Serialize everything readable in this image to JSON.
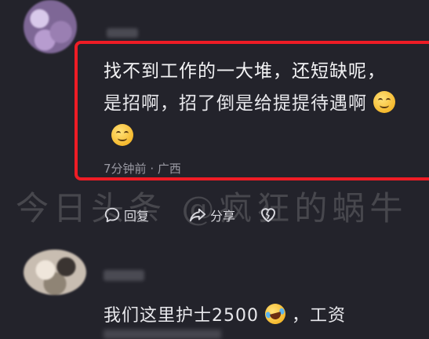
{
  "comment1": {
    "line1": "找不到工作的一大堆，还短缺呢，",
    "line2": "是招啊，招了倒是给提提待遇啊",
    "time": "7分钟前",
    "region": "广西",
    "separator": "·"
  },
  "actions": {
    "reply_label": "回复",
    "share_label": "分享"
  },
  "watermark": "今日头条 @疯狂的蜗牛",
  "comment2": {
    "text_before": "我们这里护士2500",
    "text_after": "，工资"
  },
  "colors": {
    "background": "#23232b",
    "highlight": "#ee1c25",
    "meta": "#9a9aa3"
  }
}
